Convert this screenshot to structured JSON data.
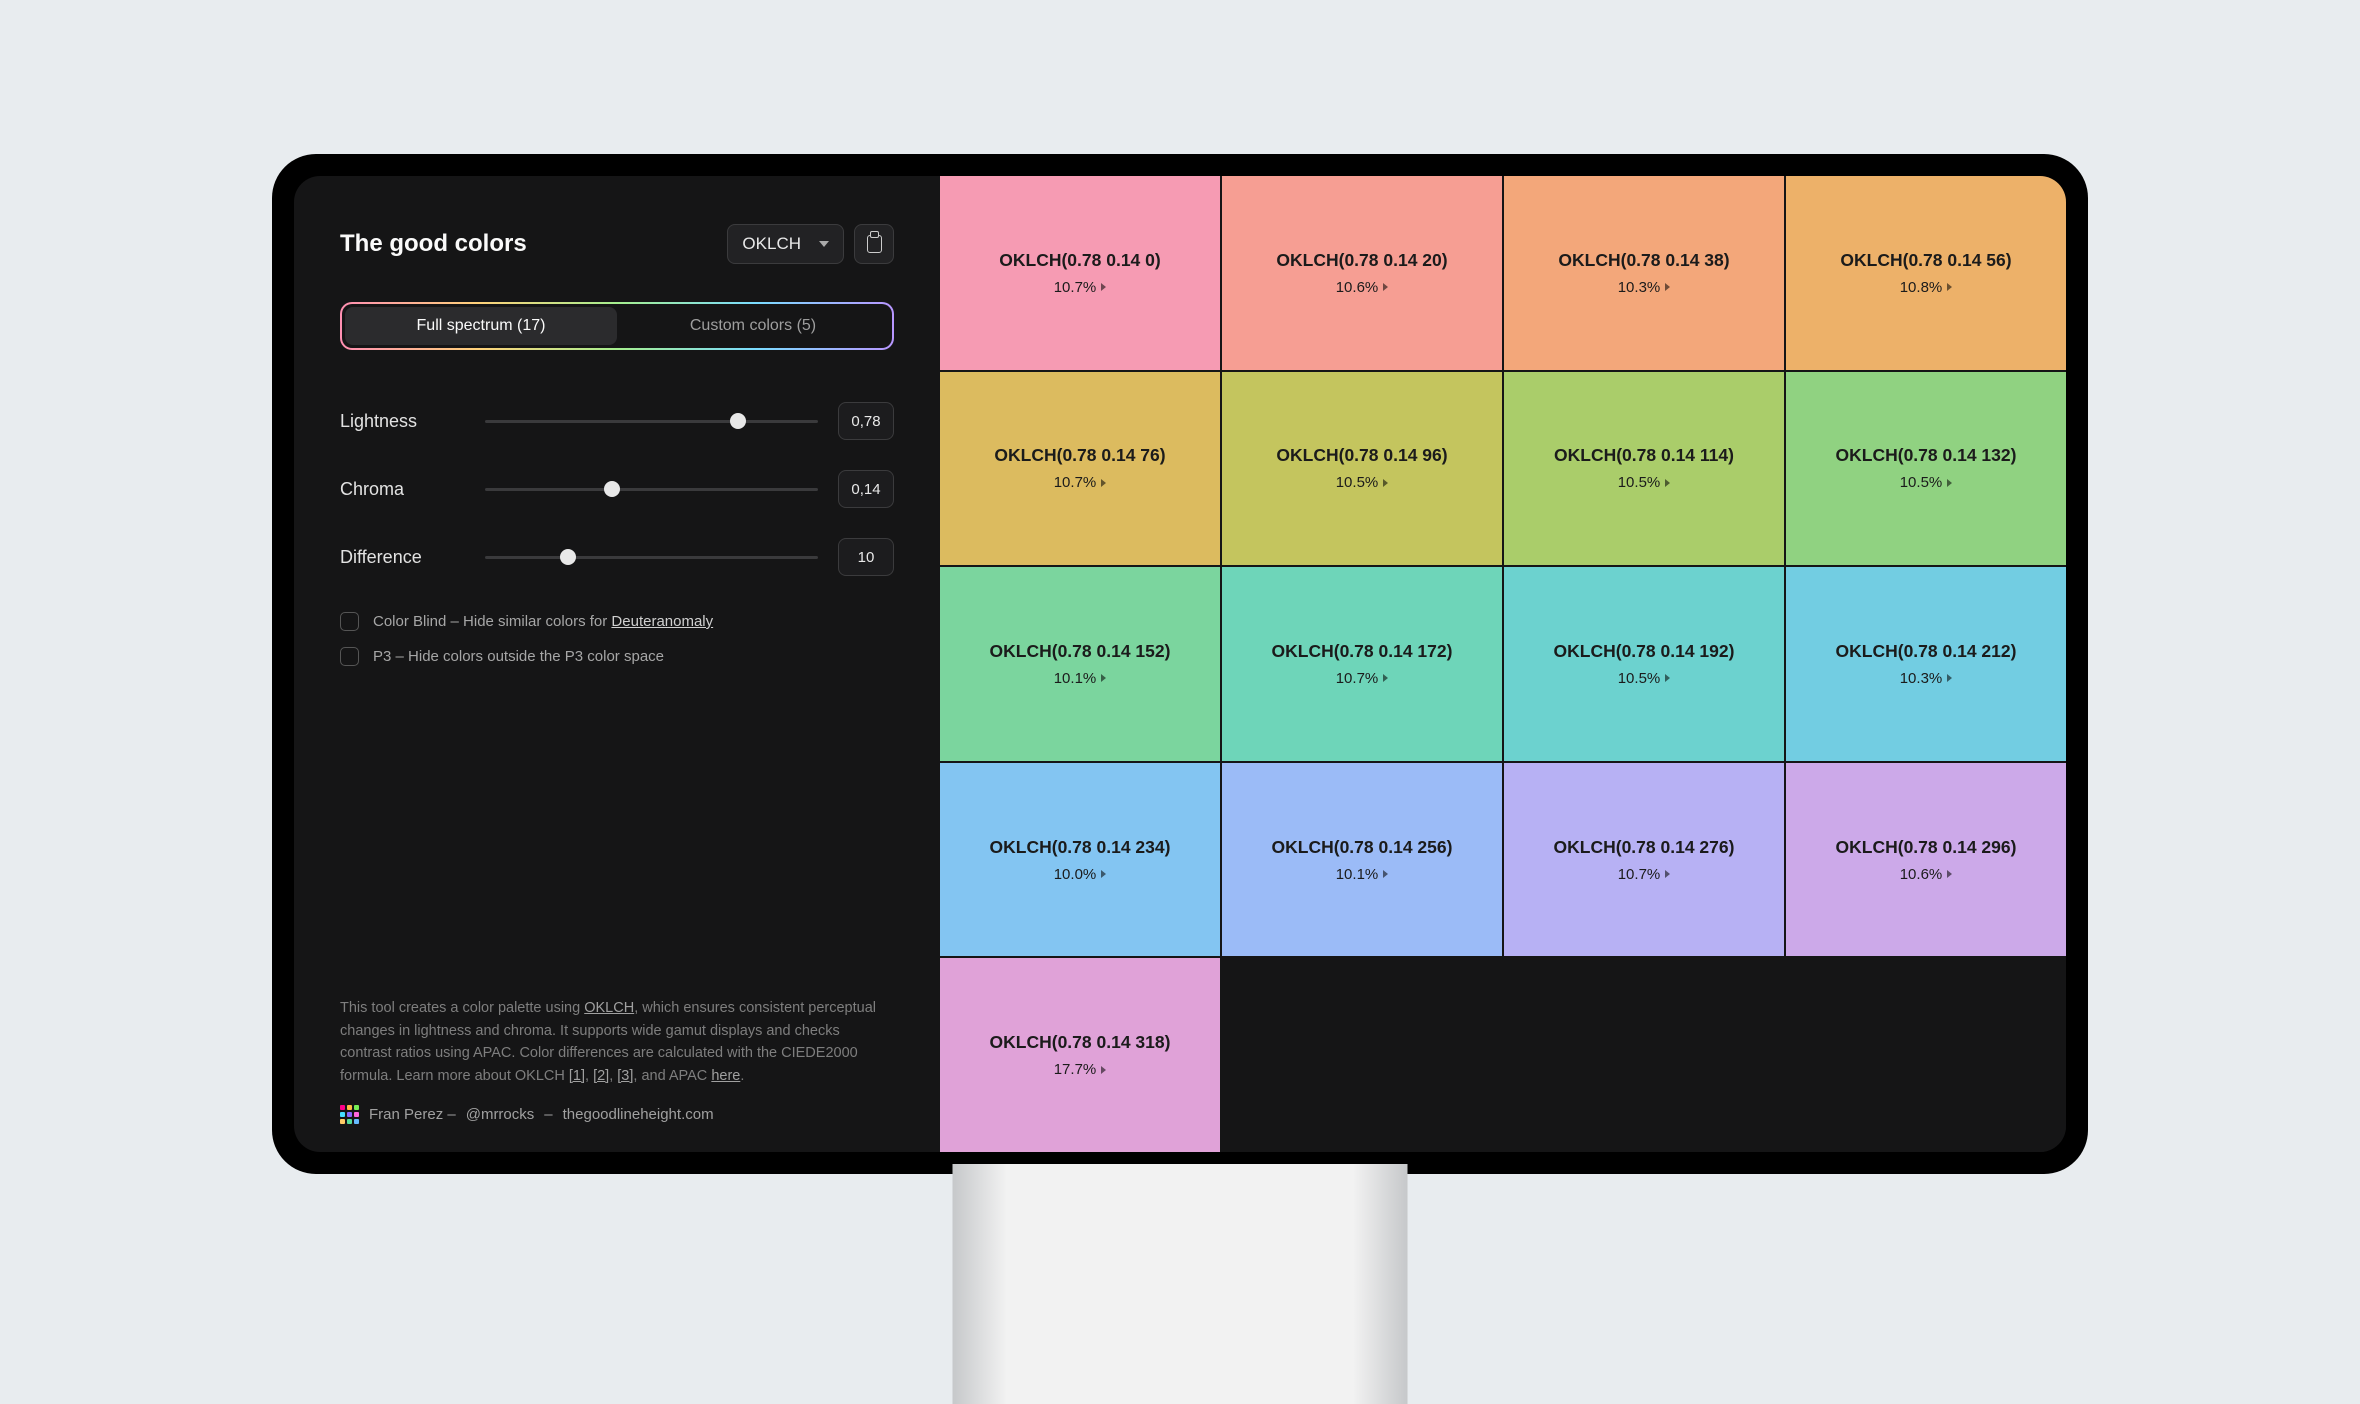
{
  "header": {
    "title": "The good colors",
    "format_select": "OKLCH"
  },
  "tabs": {
    "full_spectrum": "Full spectrum (17)",
    "custom_colors": "Custom colors (5)"
  },
  "controls": {
    "lightness": {
      "label": "Lightness",
      "value": "0,78",
      "pct": 76
    },
    "chroma": {
      "label": "Chroma",
      "value": "0,14",
      "pct": 38
    },
    "difference": {
      "label": "Difference",
      "value": "10",
      "pct": 25
    }
  },
  "checkboxes": {
    "colorblind_prefix": "Color Blind – Hide similar colors for ",
    "colorblind_link": "Deuteranomaly",
    "p3": "P3 – Hide colors outside the P3 color space"
  },
  "footer": {
    "text_1": "This tool creates a color palette using ",
    "link_oklch": "OKLCH",
    "text_2": ", which ensures consistent perceptual changes in lightness and chroma. It supports wide gamut displays and checks contrast ratios using APAC. Color differences are calculated with the CIEDE2000 formula. Learn more about OKLCH ",
    "link_1": "[1]",
    "sep_a": ", ",
    "link_2": "[2]",
    "sep_b": ", ",
    "link_3": "[3]",
    "text_3": ", and APAC ",
    "link_here": "here",
    "text_4": "."
  },
  "credits": {
    "name": "Fran Perez –",
    "handle": "@mrrocks",
    "dash": "–",
    "site": "thegoodlineheight.com"
  },
  "swatches": [
    {
      "code": "OKLCH(0.78 0.14 0)",
      "pct": "10.7%",
      "bg": "#f69bb3"
    },
    {
      "code": "OKLCH(0.78 0.14 20)",
      "pct": "10.6%",
      "bg": "#f69e93"
    },
    {
      "code": "OKLCH(0.78 0.14 38)",
      "pct": "10.3%",
      "bg": "#f3a77a"
    },
    {
      "code": "OKLCH(0.78 0.14 56)",
      "pct": "10.8%",
      "bg": "#edb169"
    },
    {
      "code": "OKLCH(0.78 0.14 76)",
      "pct": "10.7%",
      "bg": "#dcbb5f"
    },
    {
      "code": "OKLCH(0.78 0.14 96)",
      "pct": "10.5%",
      "bg": "#c4c55e"
    },
    {
      "code": "OKLCH(0.78 0.14 114)",
      "pct": "10.5%",
      "bg": "#aacd6a"
    },
    {
      "code": "OKLCH(0.78 0.14 132)",
      "pct": "10.5%",
      "bg": "#90d281"
    },
    {
      "code": "OKLCH(0.78 0.14 152)",
      "pct": "10.1%",
      "bg": "#7bd59e"
    },
    {
      "code": "OKLCH(0.78 0.14 172)",
      "pct": "10.7%",
      "bg": "#6ed5b9"
    },
    {
      "code": "OKLCH(0.78 0.14 192)",
      "pct": "10.5%",
      "bg": "#6cd2cf"
    },
    {
      "code": "OKLCH(0.78 0.14 212)",
      "pct": "10.3%",
      "bg": "#72cde2"
    },
    {
      "code": "OKLCH(0.78 0.14 234)",
      "pct": "10.0%",
      "bg": "#83c5f2"
    },
    {
      "code": "OKLCH(0.78 0.14 256)",
      "pct": "10.1%",
      "bg": "#9bbbf7"
    },
    {
      "code": "OKLCH(0.78 0.14 276)",
      "pct": "10.7%",
      "bg": "#b7b1f4"
    },
    {
      "code": "OKLCH(0.78 0.14 296)",
      "pct": "10.6%",
      "bg": "#cca9e9"
    },
    {
      "code": "OKLCH(0.78 0.14 318)",
      "pct": "17.7%",
      "bg": "#e0a2d8"
    }
  ]
}
